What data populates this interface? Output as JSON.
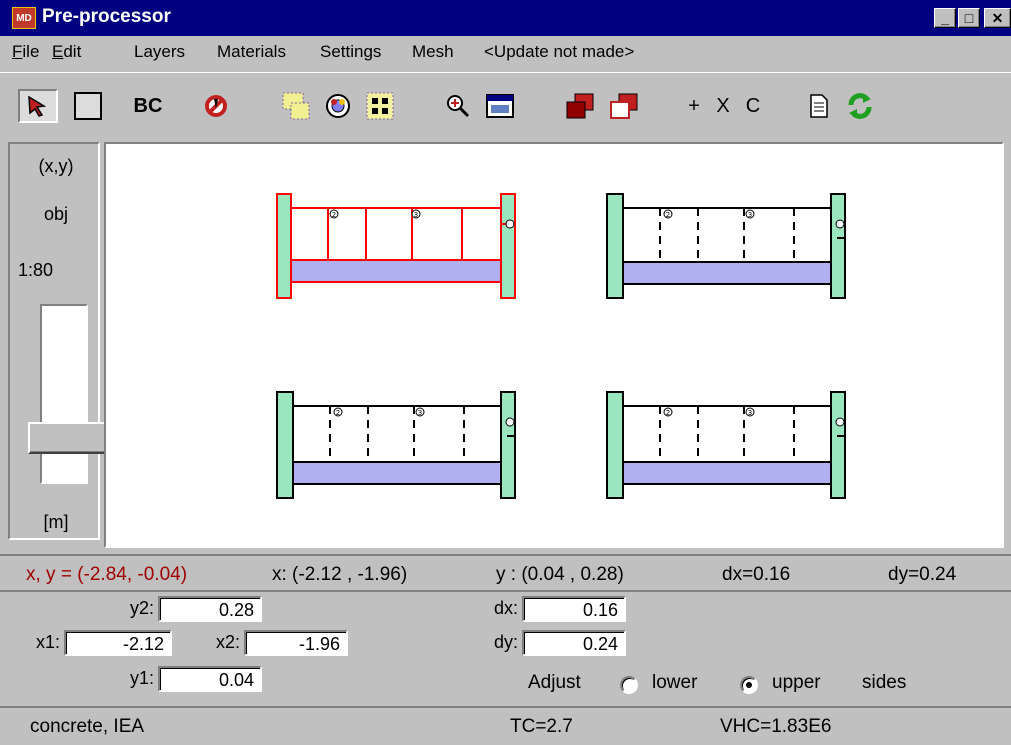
{
  "window": {
    "title": "Pre-processor",
    "icon_label": "MD",
    "buttons": [
      "_",
      "□",
      "✕"
    ]
  },
  "menu": [
    {
      "label": "File",
      "accel": "F",
      "rest": "ile"
    },
    {
      "label": "Edit",
      "accel": "E",
      "rest": "dit"
    },
    {
      "label": "Layers",
      "accel": "",
      "rest": "Layers"
    },
    {
      "label": "Materials",
      "accel": "",
      "rest": "Materials"
    },
    {
      "label": "Settings",
      "accel": "",
      "rest": "Settings"
    },
    {
      "label": "Mesh",
      "accel": "",
      "rest": "Mesh"
    },
    {
      "label": "<Update not made>",
      "accel": "",
      "rest": "<Update not made>"
    }
  ],
  "toolbar": {
    "bc_label": "BC",
    "plus_label": "+",
    "x_label": "X",
    "c_label": "C",
    "icons": [
      "pointer-icon",
      "rectangle-icon",
      "no-entry-icon",
      "select-region-icon",
      "layer-toggle-icon",
      "node-grid-icon",
      "zoom-in-icon",
      "window-icon",
      "copy-filled-icon",
      "copy-outline-icon",
      "document-icon",
      "refresh-icon"
    ],
    "accent_red": "#c02020",
    "accent_green": "#20a020"
  },
  "leftpanel": {
    "coord_label": "(x,y)",
    "obj_label": "obj",
    "scale_label": "1:80",
    "unit_label": "[m]",
    "zoom_level": 0.7
  },
  "coords": {
    "cursor": "x, y = (-2.84, -0.04)",
    "x_range": "x:  (-2.12 ,  -1.96)",
    "y_range": "y :  (0.04 ,  0.28)",
    "dx": "dx=0.16",
    "dy": "dy=0.24",
    "cursor_color": "#a00000"
  },
  "fields": {
    "y2_label": "y2:",
    "y2": "0.28",
    "x1_label": "x1:",
    "x1": "-2.12",
    "x2_label": "x2:",
    "x2": "-1.96",
    "y1_label": "y1:",
    "y1": "0.04",
    "dx_label": "dx:",
    "dx": "0.16",
    "dy_label": "dy:",
    "dy": "0.24"
  },
  "adjust": {
    "label": "Adjust",
    "lower": "lower",
    "upper": "upper",
    "sides": "sides",
    "selected": "upper"
  },
  "status": {
    "material": "concrete, IEA",
    "tc": "TC=2.7",
    "vhc": "VHC=1.83E6"
  },
  "canvas_markers": {
    "two": "2",
    "three": "3"
  },
  "colors": {
    "wall_fill": "#99e6bf",
    "slab_fill": "#b0b0f0",
    "selected": "#ff0000"
  }
}
